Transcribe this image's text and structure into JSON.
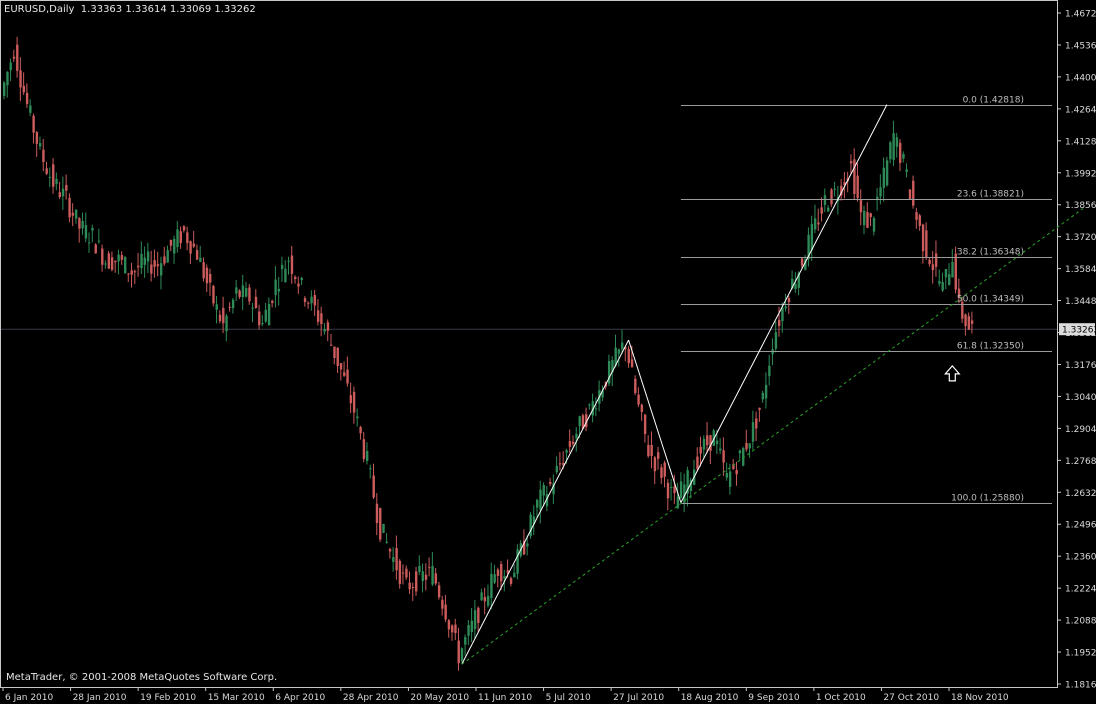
{
  "header": {
    "symbol": "EURUSD,Daily",
    "ohlc": "1.33363 1.33614 1.33069 1.33262"
  },
  "footer": {
    "copyright": "MetaTrader, © 2001-2008 MetaQuotes Software Corp."
  },
  "colors": {
    "background": "#000000",
    "frame": "#c8c8c8",
    "bull": "#2e8b57",
    "bear": "#cd5c5c",
    "fib": "#9a9a9a",
    "trend": "#ffffff",
    "support": "#2aa02a",
    "axis_text": "#d8d8d8"
  },
  "chart_data": {
    "type": "candlestick",
    "symbol": "EURUSD",
    "timeframe": "Daily",
    "ylim": [
      1.1816,
      1.4672
    ],
    "y_ticks": [
      "1.46720",
      "1.45360",
      "1.44000",
      "1.42640",
      "1.41280",
      "1.39920",
      "1.38560",
      "1.37200",
      "1.35840",
      "1.34480",
      "1.33120",
      "1.31760",
      "1.30400",
      "1.29040",
      "1.27680",
      "1.26320",
      "1.24960",
      "1.23600",
      "1.22240",
      "1.20880",
      "1.19520",
      "1.18160"
    ],
    "x_ticks": [
      "6 Jan 2010",
      "28 Jan 2010",
      "19 Feb 2010",
      "15 Mar 2010",
      "6 Apr 2010",
      "28 Apr 2010",
      "20 May 2010",
      "11 Jun 2010",
      "5 Jul 2010",
      "27 Jul 2010",
      "18 Aug 2010",
      "9 Sep 2010",
      "1 Oct 2010",
      "27 Oct 2010",
      "18 Nov 2010"
    ],
    "current_price": "1.33262",
    "path": [
      [
        0,
        1.432
      ],
      [
        4,
        1.452
      ],
      [
        8,
        1.428
      ],
      [
        12,
        1.408
      ],
      [
        16,
        1.395
      ],
      [
        20,
        1.388
      ],
      [
        24,
        1.376
      ],
      [
        28,
        1.372
      ],
      [
        32,
        1.362
      ],
      [
        36,
        1.362
      ],
      [
        40,
        1.357
      ],
      [
        44,
        1.361
      ],
      [
        48,
        1.36
      ],
      [
        52,
        1.368
      ],
      [
        56,
        1.374
      ],
      [
        60,
        1.365
      ],
      [
        64,
        1.348
      ],
      [
        68,
        1.334
      ],
      [
        72,
        1.348
      ],
      [
        76,
        1.346
      ],
      [
        80,
        1.335
      ],
      [
        84,
        1.352
      ],
      [
        88,
        1.363
      ],
      [
        92,
        1.35
      ],
      [
        96,
        1.341
      ],
      [
        100,
        1.33
      ],
      [
        104,
        1.315
      ],
      [
        108,
        1.298
      ],
      [
        112,
        1.276
      ],
      [
        116,
        1.248
      ],
      [
        120,
        1.235
      ],
      [
        124,
        1.223
      ],
      [
        128,
        1.227
      ],
      [
        132,
        1.229
      ],
      [
        136,
        1.213
      ],
      [
        140,
        1.194
      ],
      [
        144,
        1.206
      ],
      [
        148,
        1.219
      ],
      [
        152,
        1.231
      ],
      [
        156,
        1.228
      ],
      [
        160,
        1.241
      ],
      [
        164,
        1.258
      ],
      [
        168,
        1.266
      ],
      [
        172,
        1.278
      ],
      [
        176,
        1.289
      ],
      [
        180,
        1.298
      ],
      [
        184,
        1.309
      ],
      [
        188,
        1.32
      ],
      [
        191,
        1.327
      ],
      [
        194,
        1.305
      ],
      [
        198,
        1.281
      ],
      [
        202,
        1.272
      ],
      [
        206,
        1.259
      ],
      [
        210,
        1.268
      ],
      [
        214,
        1.281
      ],
      [
        218,
        1.287
      ],
      [
        222,
        1.269
      ],
      [
        226,
        1.278
      ],
      [
        230,
        1.29
      ],
      [
        233,
        1.303
      ],
      [
        236,
        1.328
      ],
      [
        240,
        1.346
      ],
      [
        244,
        1.358
      ],
      [
        248,
        1.373
      ],
      [
        252,
        1.387
      ],
      [
        256,
        1.392
      ],
      [
        260,
        1.402
      ],
      [
        263,
        1.381
      ],
      [
        266,
        1.378
      ],
      [
        270,
        1.397
      ],
      [
        273,
        1.415
      ],
      [
        276,
        1.403
      ],
      [
        279,
        1.385
      ],
      [
        282,
        1.37
      ],
      [
        285,
        1.36
      ],
      [
        288,
        1.35
      ],
      [
        291,
        1.364
      ],
      [
        293,
        1.342
      ],
      [
        296,
        1.333
      ]
    ],
    "trend_lines": [
      {
        "from": [
          140,
          1.19
        ],
        "to": [
          191,
          1.328
        ]
      },
      {
        "from": [
          191,
          1.328
        ],
        "to": [
          207,
          1.2588
        ]
      },
      {
        "from": [
          207,
          1.2588
        ],
        "to": [
          270,
          1.4282
        ]
      }
    ],
    "support_line": {
      "from": [
        140,
        1.19
      ],
      "to": [
        330,
        1.384
      ]
    },
    "fibonacci": {
      "start_day": 207,
      "high": 1.42818,
      "low": 1.2588,
      "levels": [
        {
          "label": "0.0 (1.42818)",
          "price": 1.42818
        },
        {
          "label": "23.6 (1.38821)",
          "price": 1.38821
        },
        {
          "label": "38.2 (1.36348)",
          "price": 1.36348
        },
        {
          "label": "50.0 (1.34349)",
          "price": 1.34349
        },
        {
          "label": "61.8 (1.32350)",
          "price": 1.3235
        },
        {
          "label": "100.0 (1.25880)",
          "price": 1.2588
        }
      ]
    },
    "arrow": {
      "day": 290,
      "price": 1.317,
      "direction": "up"
    }
  }
}
